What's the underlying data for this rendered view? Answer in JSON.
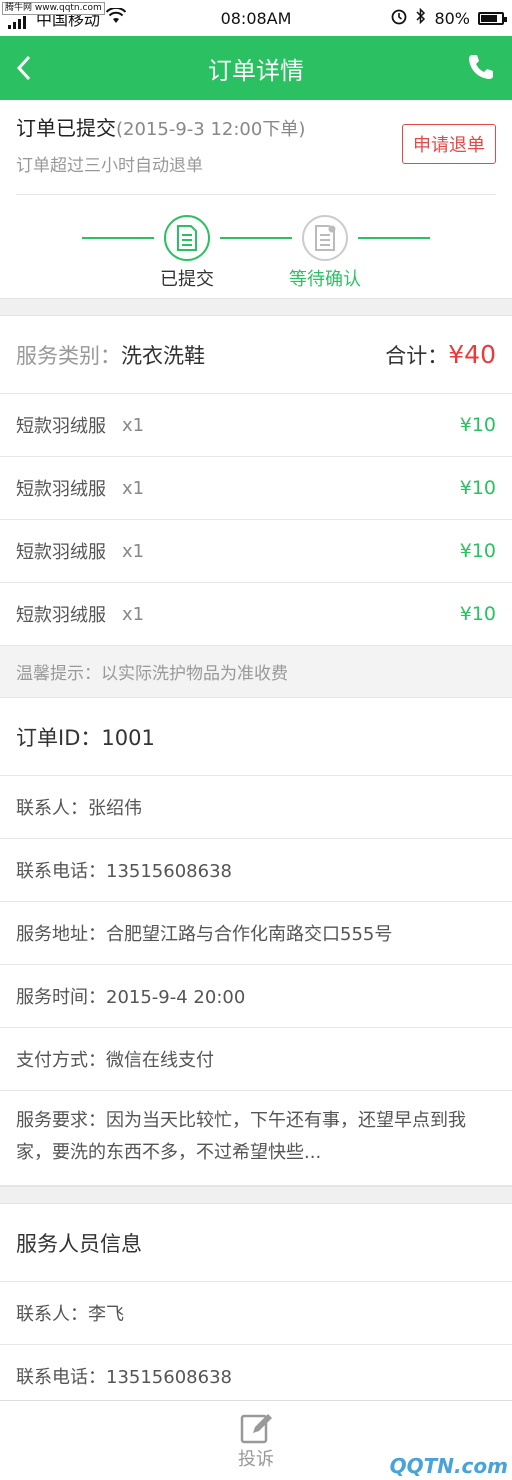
{
  "statusbar": {
    "watermark": "腾牛网 www.qqtn.com",
    "carrier": "中国移动",
    "time": "08:08AM",
    "battery": "80%",
    "battery_level": 0.8
  },
  "nav": {
    "title": "订单详情"
  },
  "order_status": {
    "title": "订单已提交",
    "time": "(2015-9-3 12:00下单)",
    "subtitle": "订单超过三小时自动退单",
    "refund_label": "申请退单",
    "steps": [
      {
        "label": "已提交"
      },
      {
        "label": "等待确认"
      }
    ]
  },
  "service": {
    "category_label": "服务类别：",
    "category_value": "洗衣洗鞋",
    "total_label": "合计：",
    "total_value": "¥40",
    "items": [
      {
        "name": "短款羽绒服",
        "qty": "x1",
        "price": "¥10"
      },
      {
        "name": "短款羽绒服",
        "qty": "x1",
        "price": "¥10"
      },
      {
        "name": "短款羽绒服",
        "qty": "x1",
        "price": "¥10"
      },
      {
        "name": "短款羽绒服",
        "qty": "x1",
        "price": "¥10"
      }
    ],
    "tip": "温馨提示：以实际洗护物品为准收费"
  },
  "order_info": {
    "order_id": "订单ID：1001",
    "contact": "联系人：张绍伟",
    "phone": "联系电话：13515608638",
    "address": "服务地址：合肥望江路与合作化南路交口555号",
    "service_time": "服务时间：2015-9-4 20:00",
    "payment": "支付方式：微信在线支付",
    "requirement": "服务要求：因为当天比较忙，下午还有事，还望早点到我家，要洗的东西不多，不过希望快些..."
  },
  "staff": {
    "title": "服务人员信息",
    "contact": "联系人：李飞",
    "phone": "联系电话：13515608638"
  },
  "bottom": {
    "complain_label": "投诉"
  },
  "watermark_bottom": "QQTN.com",
  "colors": {
    "accent": "#2bc163",
    "danger": "#e24a4a"
  }
}
